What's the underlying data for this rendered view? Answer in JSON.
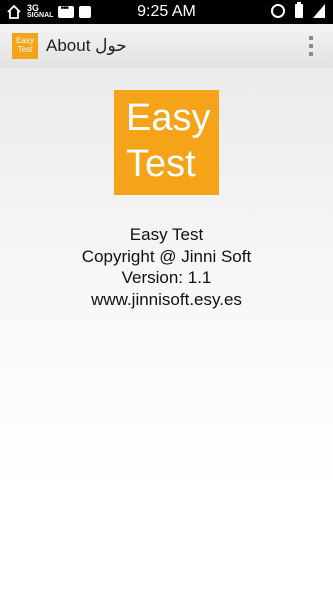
{
  "status_bar": {
    "network_type": "3G",
    "network_label": "SIGNAL",
    "time": "9:25 AM"
  },
  "app_bar": {
    "icon_line1": "Easy",
    "icon_line2": "Test",
    "title": "About حول"
  },
  "logo": {
    "line1": "Easy",
    "line2": "Test",
    "color": "#f5a318"
  },
  "about": {
    "app_name": "Easy Test",
    "copyright": "Copyright @ Jinni Soft",
    "version": "Version: 1.1",
    "website": "www.jinnisoft.esy.es"
  }
}
